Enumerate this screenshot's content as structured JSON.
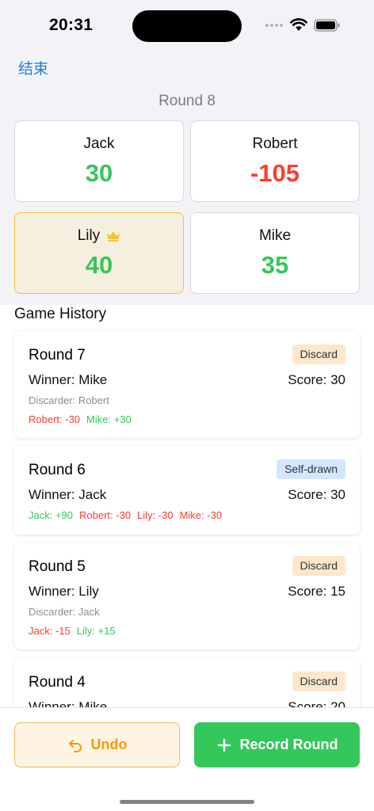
{
  "status": {
    "time": "20:31"
  },
  "nav": {
    "end_label": "结束"
  },
  "current_round": "Round 8",
  "players": [
    {
      "name": "Jack",
      "score": "30",
      "tone": "positive",
      "leader": false
    },
    {
      "name": "Robert",
      "score": "-105",
      "tone": "negative",
      "leader": false
    },
    {
      "name": "Lily",
      "score": "40",
      "tone": "positive",
      "leader": true,
      "leader_icon": "crown-icon"
    },
    {
      "name": "Mike",
      "score": "35",
      "tone": "positive",
      "leader": false
    }
  ],
  "history": {
    "heading": "Game History",
    "rounds": [
      {
        "title": "Round 7",
        "badge": "Discard",
        "badge_type": "discard",
        "winner": "Winner: Mike",
        "score": "Score: 30",
        "discarder": "Discarder: Robert",
        "changes": [
          {
            "text": "Robert: -30",
            "tone": "negative"
          },
          {
            "text": "Mike: +30",
            "tone": "positive"
          }
        ]
      },
      {
        "title": "Round 6",
        "badge": "Self-drawn",
        "badge_type": "self",
        "winner": "Winner: Jack",
        "score": "Score: 30",
        "changes": [
          {
            "text": "Jack: +90",
            "tone": "positive"
          },
          {
            "text": "Robert: -30",
            "tone": "negative"
          },
          {
            "text": "Lily: -30",
            "tone": "negative"
          },
          {
            "text": "Mike: -30",
            "tone": "negative"
          }
        ]
      },
      {
        "title": "Round 5",
        "badge": "Discard",
        "badge_type": "discard",
        "winner": "Winner: Lily",
        "score": "Score: 15",
        "discarder": "Discarder: Jack",
        "changes": [
          {
            "text": "Jack: -15",
            "tone": "negative"
          },
          {
            "text": "Lily: +15",
            "tone": "positive"
          }
        ]
      },
      {
        "title": "Round 4",
        "badge": "Discard",
        "badge_type": "discard",
        "winner": "Winner: Mike",
        "score": "Score: 20"
      }
    ]
  },
  "actions": {
    "undo_label": "Undo",
    "undo_icon": "undo-arrow-icon",
    "record_label": "Record Round",
    "record_icon": "plus-icon"
  },
  "colors": {
    "positive": "#34c759",
    "negative": "#ff3b30",
    "accent_blue": "#1a80e6",
    "leader_highlight": "#f1c531",
    "undo_orange": "#f59a0b"
  }
}
